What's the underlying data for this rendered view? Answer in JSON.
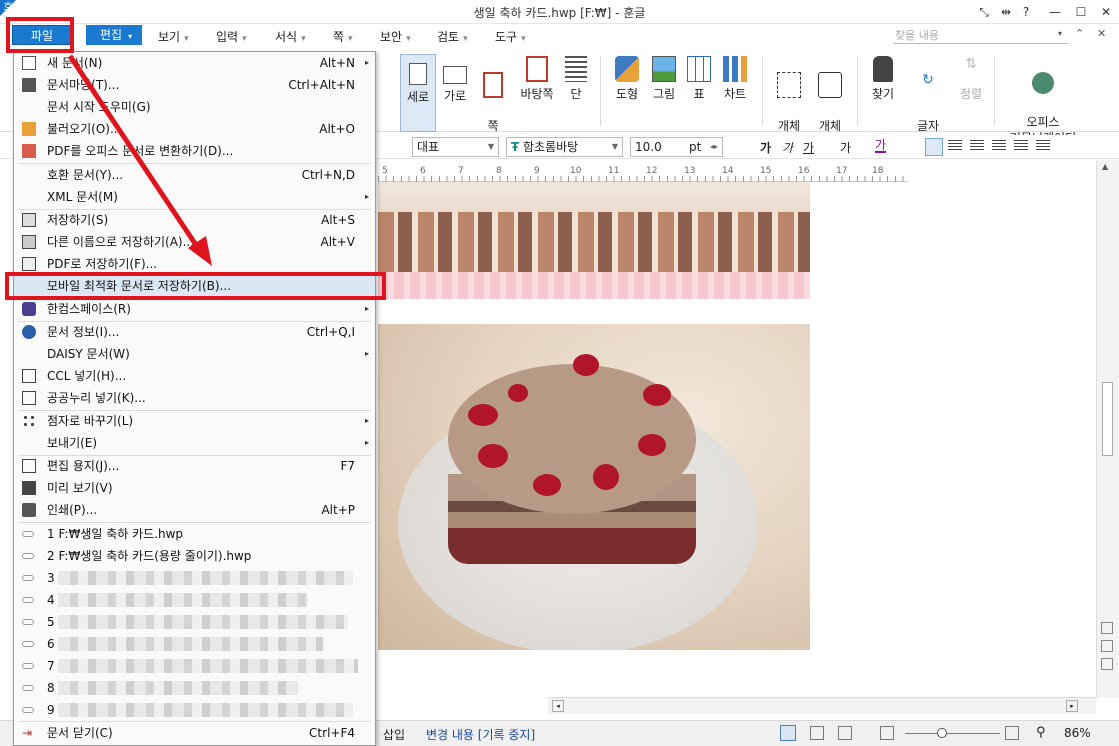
{
  "window": {
    "title": "생일 축하 카드.hwp [F:₩] - 훈글",
    "logo": "호"
  },
  "menubar": {
    "file": "파일",
    "edit": "편집",
    "items": [
      {
        "label": "보기"
      },
      {
        "label": "입력"
      },
      {
        "label": "서식"
      },
      {
        "label": "쪽"
      },
      {
        "label": "보안"
      },
      {
        "label": "검토"
      },
      {
        "label": "도구"
      }
    ],
    "find_placeholder": "찾을 내용"
  },
  "ribbon": {
    "buttons": [
      {
        "label": "세로"
      },
      {
        "label": "가로"
      },
      {
        "label": "쪽\n여백"
      },
      {
        "label": "바탕쪽"
      },
      {
        "label": "단"
      },
      {
        "label": "도형"
      },
      {
        "label": "그림"
      },
      {
        "label": "표"
      },
      {
        "label": "차트"
      },
      {
        "label": "개체\n선택"
      },
      {
        "label": "개체\n보호"
      },
      {
        "label": "찾기"
      },
      {
        "label": "글자\n바꾸기"
      },
      {
        "label": "정렬"
      },
      {
        "label": "오피스\n커뮤니케이터"
      }
    ]
  },
  "format": {
    "style": "대표",
    "font": "함초롬바탕",
    "size": "10.0",
    "size_unit": "pt",
    "buttons": [
      "가",
      "가",
      "가",
      "가",
      "가"
    ]
  },
  "ruler": {
    "ticks": [
      "5",
      "6",
      "7",
      "8",
      "9",
      "10",
      "11",
      "12",
      "13",
      "14",
      "15",
      "16",
      "17",
      "18"
    ]
  },
  "file_menu": {
    "rows": [
      {
        "label": "새 문서(N)",
        "shortcut": "Alt+N",
        "submenu": true
      },
      {
        "label": "문서마당(T)...",
        "shortcut": "Ctrl+Alt+N"
      },
      {
        "label": "문서 시작 도우미(G)",
        "shortcut": ""
      },
      {
        "label": "불러오기(O)...",
        "shortcut": "Alt+O"
      },
      {
        "label": "PDF를 오피스 문서로 변환하기(D)...",
        "shortcut": ""
      },
      {
        "label": "호환 문서(Y)...",
        "shortcut": "Ctrl+N,D"
      },
      {
        "label": "XML 문서(M)",
        "shortcut": "",
        "submenu": true
      },
      {
        "label": "저장하기(S)",
        "shortcut": "Alt+S"
      },
      {
        "label": "다른 이름으로 저장하기(A)...",
        "shortcut": "Alt+V"
      },
      {
        "label": "PDF로 저장하기(F)...",
        "shortcut": ""
      },
      {
        "label": "모바일 최적화 문서로 저장하기(B)...",
        "shortcut": ""
      },
      {
        "label": "한컴스페이스(R)",
        "shortcut": "",
        "submenu": true
      },
      {
        "label": "문서 정보(I)...",
        "shortcut": "Ctrl+Q,I"
      },
      {
        "label": "DAISY 문서(W)",
        "shortcut": "",
        "submenu": true
      },
      {
        "label": "CCL 넣기(H)...",
        "shortcut": ""
      },
      {
        "label": "공공누리 넣기(K)...",
        "shortcut": ""
      },
      {
        "label": "점자로 바꾸기(L)",
        "shortcut": "",
        "submenu": true
      },
      {
        "label": "보내기(E)",
        "shortcut": "",
        "submenu": true
      },
      {
        "label": "편집 용지(J)...",
        "shortcut": "F7"
      },
      {
        "label": "미리 보기(V)",
        "shortcut": ""
      },
      {
        "label": "인쇄(P)...",
        "shortcut": "Alt+P"
      }
    ],
    "recent": [
      {
        "label": "1 F:₩생일 축하 카드.hwp"
      },
      {
        "label": "2 F:₩생일 축하 카드(용량 줄이기).hwp"
      },
      {
        "label": "3"
      },
      {
        "label": "4"
      },
      {
        "label": "5"
      },
      {
        "label": "6"
      },
      {
        "label": "7"
      },
      {
        "label": "8"
      },
      {
        "label": "9"
      }
    ],
    "close": {
      "label": "문서 닫기(C)",
      "shortcut": "Ctrl+F4"
    }
  },
  "status": {
    "insert": "삽입",
    "track": "변경 내용 [기록 중지]",
    "zoom": "86%"
  },
  "colors": {
    "accent": "#1a7ad0",
    "highlight": "#e0141c"
  }
}
